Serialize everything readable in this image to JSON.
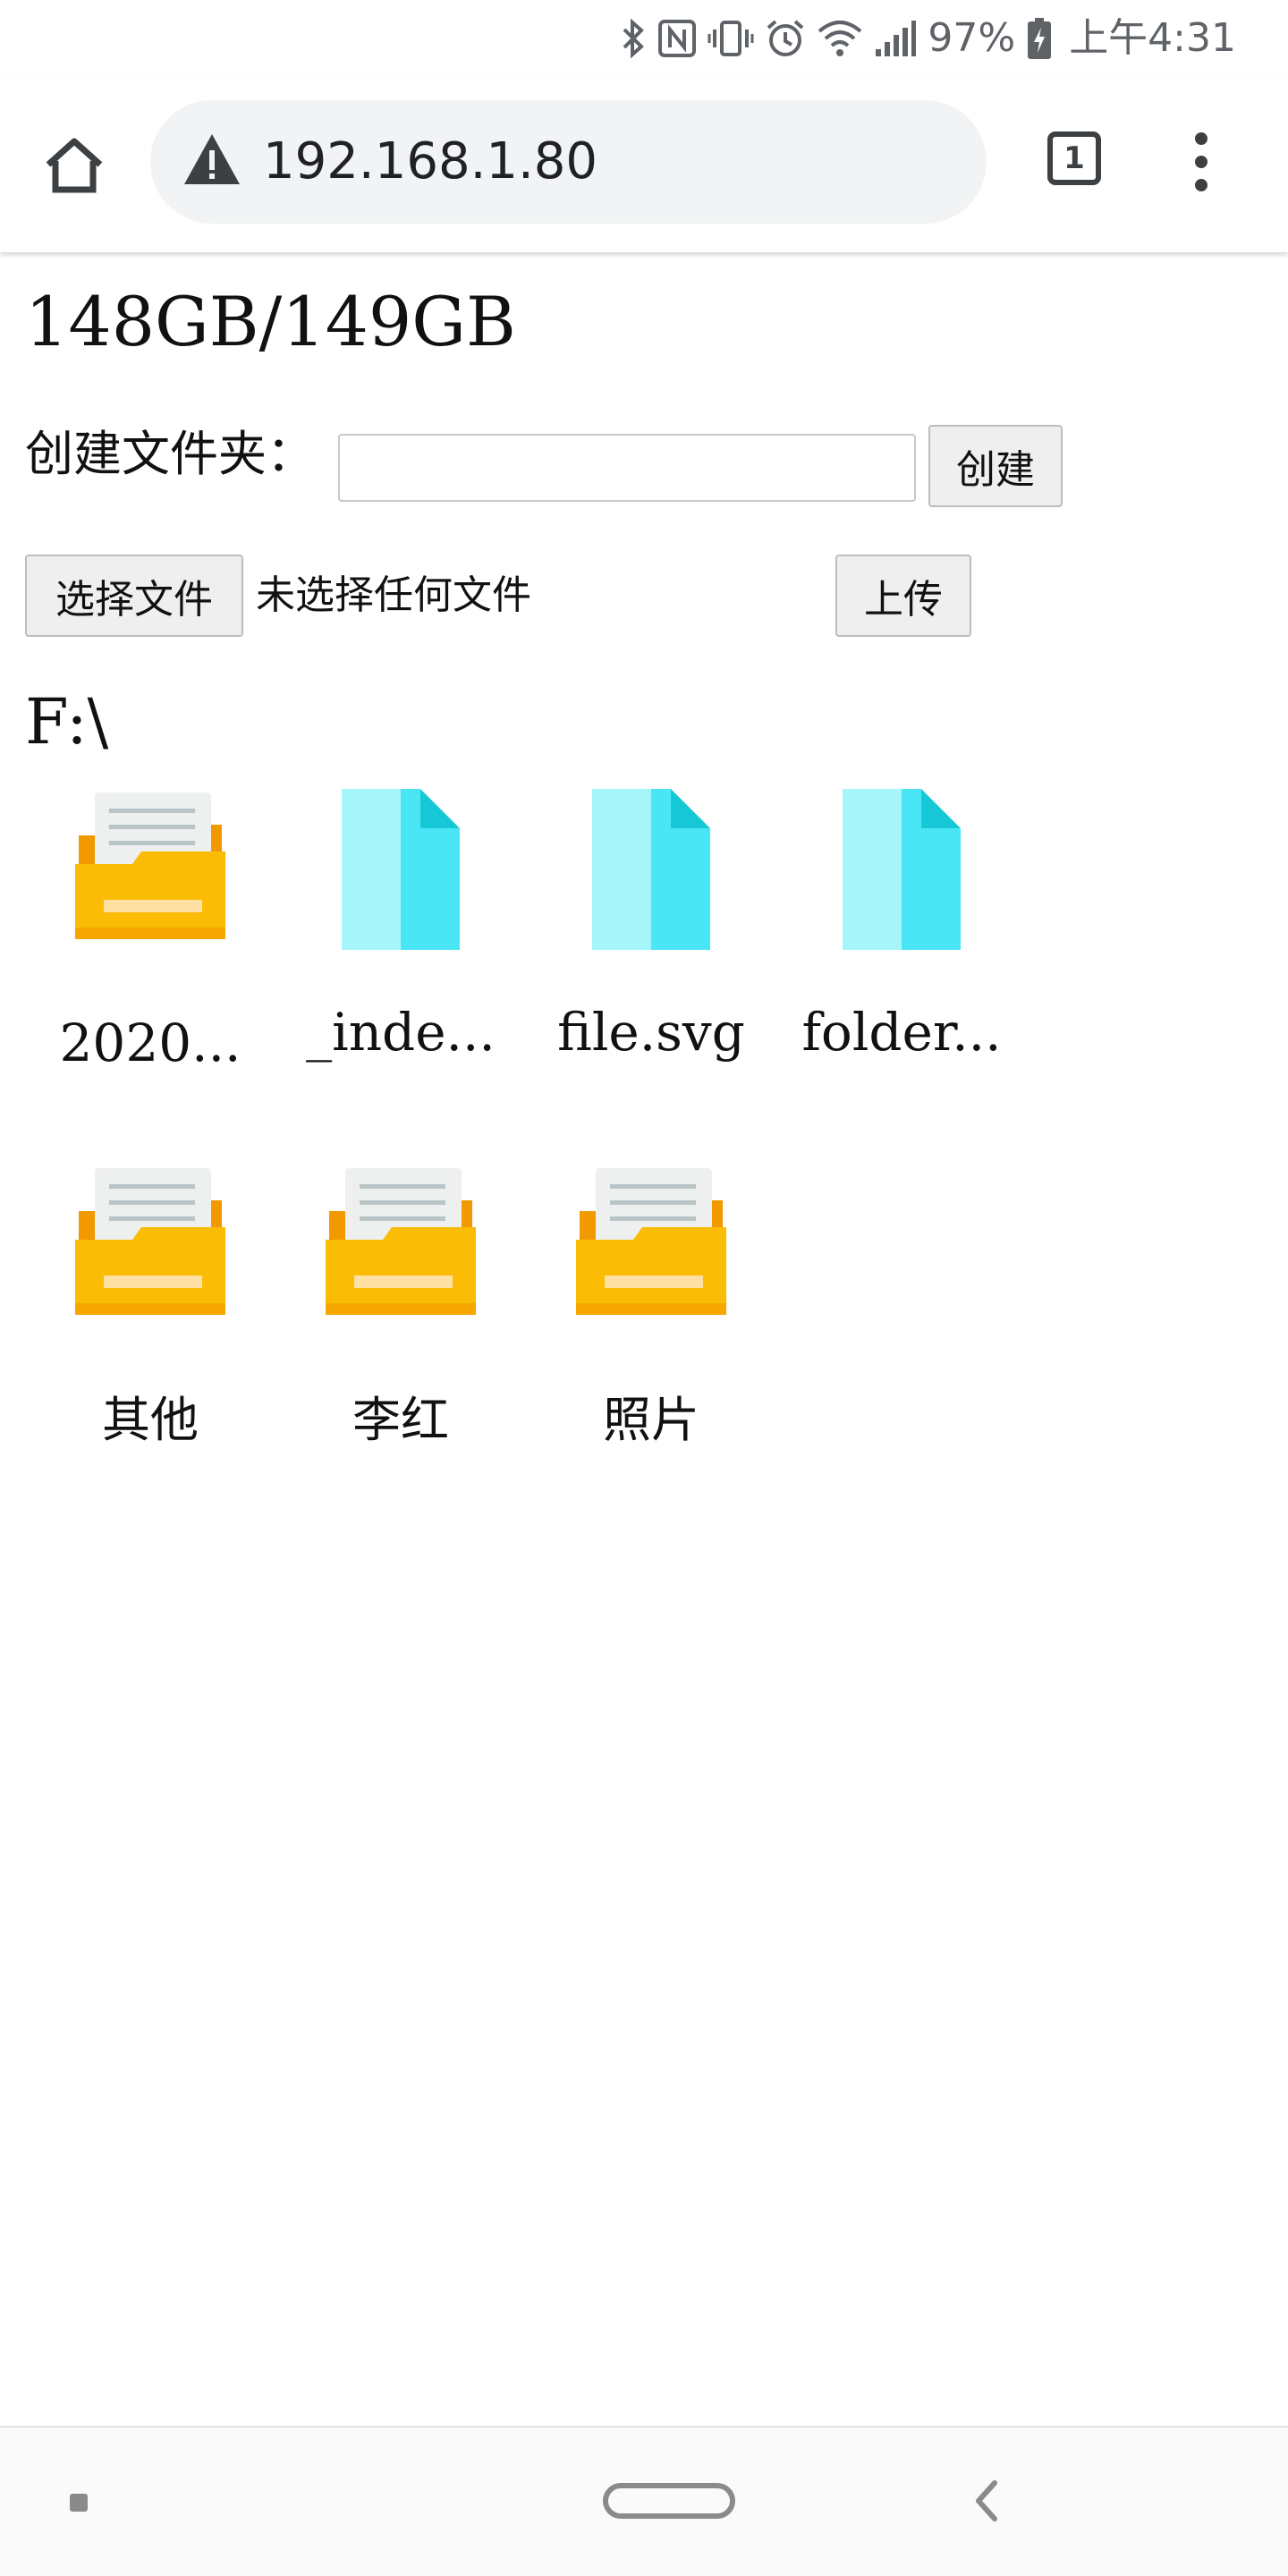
{
  "status_bar": {
    "battery": "97%",
    "time": "上午4:31",
    "icons": [
      "bluetooth-icon",
      "nfc-icon",
      "vibrate-icon",
      "alarm-icon",
      "wifi-icon",
      "signal-icon",
      "battery-charging-icon"
    ]
  },
  "browser": {
    "url": "192.168.1.80",
    "tab_count": "1",
    "icons": [
      "home-icon",
      "warning-icon",
      "tab-switcher-icon",
      "more-vert-icon"
    ]
  },
  "page": {
    "storage": "148GB/149GB",
    "create_folder_label": "创建文件夹：",
    "create_folder_input_value": "",
    "create_button": "创建",
    "choose_file_button": "选择文件",
    "no_file_text": "未选择任何文件",
    "upload_button": "上传",
    "current_path": "F:\\",
    "items": [
      {
        "name": "2020...",
        "type": "folder"
      },
      {
        "name": "_inde...",
        "type": "file"
      },
      {
        "name": "file.svg",
        "type": "file"
      },
      {
        "name": "folder...",
        "type": "file"
      },
      {
        "name": "其他",
        "type": "folder"
      },
      {
        "name": "李红",
        "type": "folder"
      },
      {
        "name": "照片",
        "type": "folder"
      }
    ]
  },
  "nav_bar": {
    "icons": [
      "recent-apps-icon",
      "home-pill-icon",
      "back-icon"
    ]
  },
  "colors": {
    "folder_yellow": "#fbbc05",
    "folder_back": "#f29900",
    "file_cyan_light": "#a5f5fb",
    "file_cyan": "#4ae6f5",
    "file_fold": "#16c8d6"
  }
}
